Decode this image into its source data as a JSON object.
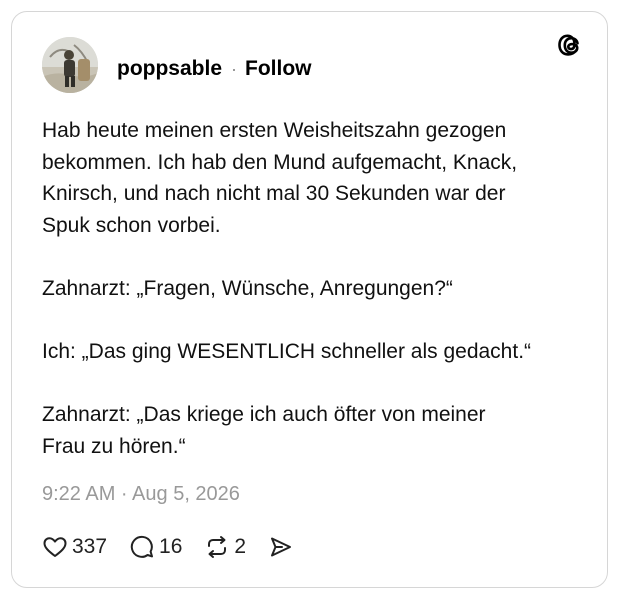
{
  "post": {
    "author": {
      "username": "poppsable",
      "avatar_icon": "avatar-photo"
    },
    "follow_label": "Follow",
    "separator": "·",
    "platform_icon": "threads-logo-icon",
    "text": "Hab heute meinen ersten Weisheitszahn gezogen\nbekommen. Ich hab den Mund aufgemacht, Knack,\nKnirsch, und nach nicht mal 30 Sekunden war der\nSpuk schon vorbei.\n\nZahnarzt: „Fragen, Wünsche, Anregungen?“\n\nIch: „Das ging WESENTLICH schneller als gedacht.“\n\nZahnarzt: „Das kriege ich auch öfter von meiner\nFrau zu hören.“",
    "timestamp": "9:22 AM · Aug 5, 2026",
    "actions": {
      "likes": {
        "icon": "heart-icon",
        "count": "337"
      },
      "replies": {
        "icon": "comment-icon",
        "count": "16"
      },
      "reposts": {
        "icon": "repost-icon",
        "count": "2"
      },
      "share": {
        "icon": "send-icon"
      }
    }
  },
  "colors": {
    "text": "#111111",
    "muted": "#999999",
    "border": "#d6d6d6",
    "background": "#ffffff"
  }
}
